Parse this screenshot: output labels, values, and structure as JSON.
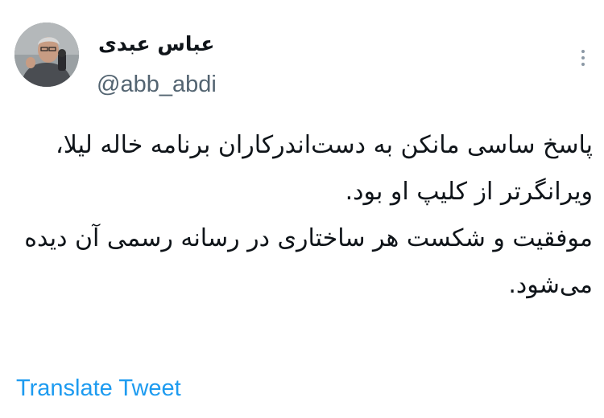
{
  "author": {
    "display_name": "عباس عبدی",
    "username": "@abb_abdi"
  },
  "tweet": {
    "lines": [
      "پاسخ ساسی مانکن به دست‌اندرکاران برنامه خاله لیلا،",
      "ویرانگرتر از کلیپ او بود.",
      "موفقیت و شکست هر ساختاری در رسانه رسمی آن دیده",
      "می‌شود."
    ]
  },
  "actions": {
    "translate_label": "Translate Tweet",
    "more_icon": "more-vertical-icon"
  },
  "colors": {
    "text": "#0f1419",
    "secondary": "#536471",
    "link": "#1d9bf0"
  }
}
